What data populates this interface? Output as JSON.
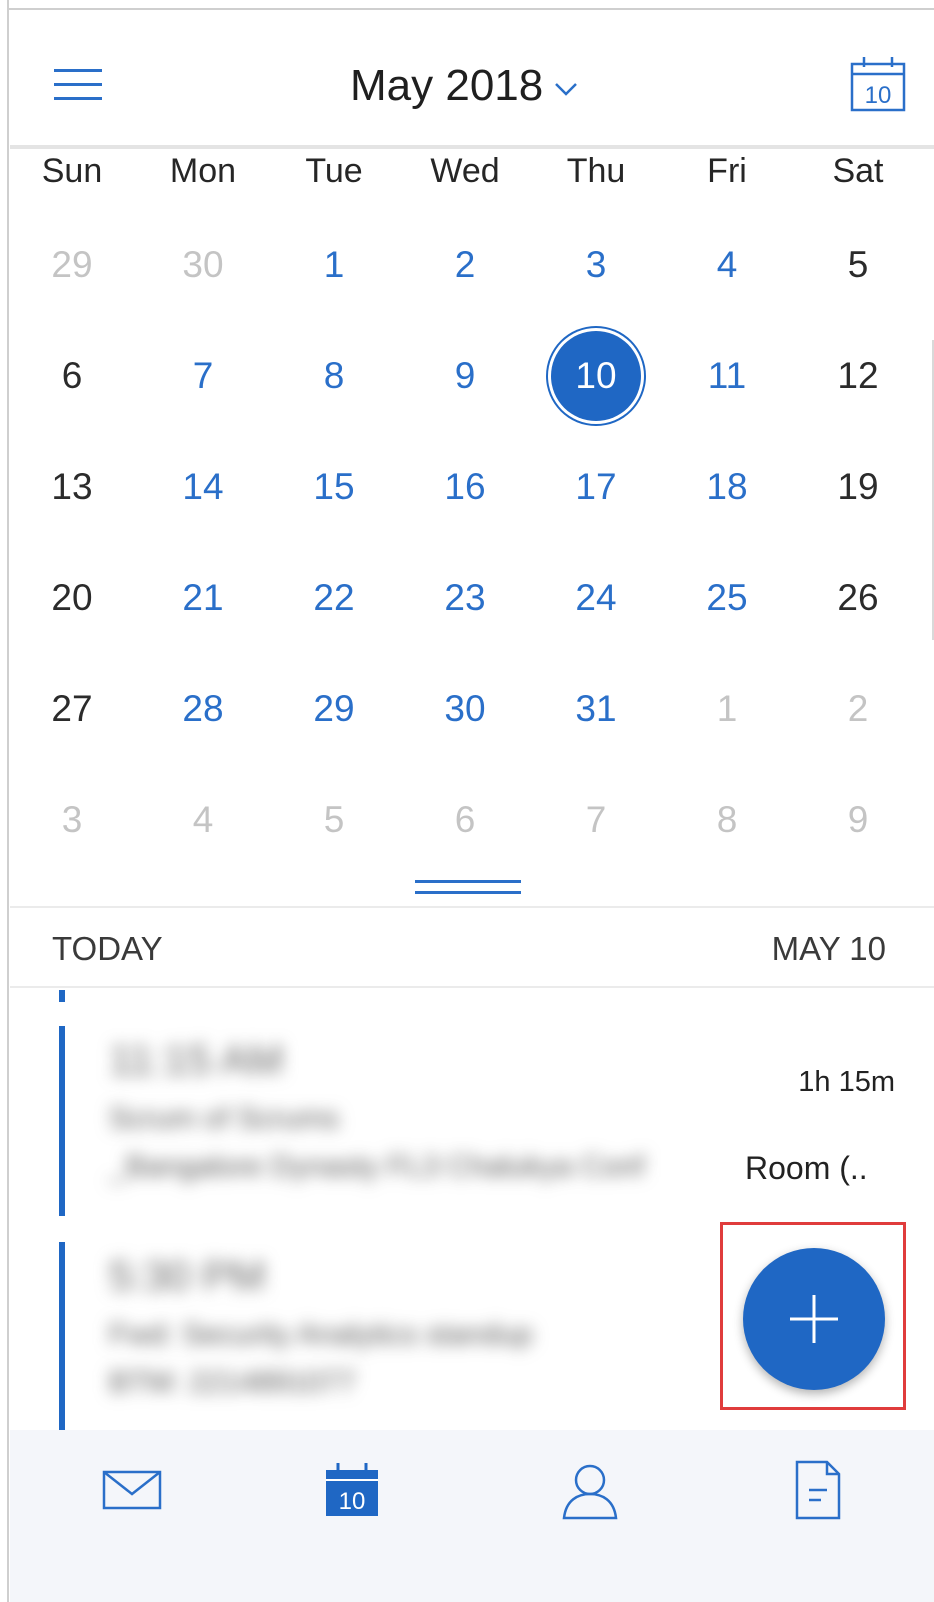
{
  "header": {
    "title": "May 2018",
    "today_icon_day": "10",
    "icons": [
      "hamburger-menu-icon",
      "chevron-down-icon",
      "calendar-today-icon"
    ]
  },
  "weekdays": [
    "Sun",
    "Mon",
    "Tue",
    "Wed",
    "Thu",
    "Fri",
    "Sat"
  ],
  "calendar": {
    "weeks": [
      [
        {
          "d": "29",
          "s": "muted"
        },
        {
          "d": "30",
          "s": "muted"
        },
        {
          "d": "1",
          "s": "week"
        },
        {
          "d": "2",
          "s": "week"
        },
        {
          "d": "3",
          "s": "week"
        },
        {
          "d": "4",
          "s": "week"
        },
        {
          "d": "5",
          "s": "weekend"
        }
      ],
      [
        {
          "d": "6",
          "s": "weekend"
        },
        {
          "d": "7",
          "s": "week"
        },
        {
          "d": "8",
          "s": "week"
        },
        {
          "d": "9",
          "s": "week"
        },
        {
          "d": "10",
          "s": "selected"
        },
        {
          "d": "11",
          "s": "week"
        },
        {
          "d": "12",
          "s": "weekend"
        }
      ],
      [
        {
          "d": "13",
          "s": "weekend"
        },
        {
          "d": "14",
          "s": "week"
        },
        {
          "d": "15",
          "s": "week"
        },
        {
          "d": "16",
          "s": "week"
        },
        {
          "d": "17",
          "s": "week"
        },
        {
          "d": "18",
          "s": "week"
        },
        {
          "d": "19",
          "s": "weekend"
        }
      ],
      [
        {
          "d": "20",
          "s": "weekend"
        },
        {
          "d": "21",
          "s": "week"
        },
        {
          "d": "22",
          "s": "week"
        },
        {
          "d": "23",
          "s": "week"
        },
        {
          "d": "24",
          "s": "week"
        },
        {
          "d": "25",
          "s": "week"
        },
        {
          "d": "26",
          "s": "weekend"
        }
      ],
      [
        {
          "d": "27",
          "s": "weekend"
        },
        {
          "d": "28",
          "s": "week"
        },
        {
          "d": "29",
          "s": "week"
        },
        {
          "d": "30",
          "s": "week"
        },
        {
          "d": "31",
          "s": "week"
        },
        {
          "d": "1",
          "s": "muted"
        },
        {
          "d": "2",
          "s": "muted"
        }
      ],
      [
        {
          "d": "3",
          "s": "muted"
        },
        {
          "d": "4",
          "s": "muted"
        },
        {
          "d": "5",
          "s": "muted"
        },
        {
          "d": "6",
          "s": "muted"
        },
        {
          "d": "7",
          "s": "muted"
        },
        {
          "d": "8",
          "s": "muted"
        },
        {
          "d": "9",
          "s": "muted"
        }
      ]
    ]
  },
  "agenda": {
    "today_label": "TODAY",
    "date_label": "MAY 10",
    "events": [
      {
        "time": "11:15 AM",
        "title": "Scrum of Scrums",
        "location": "_Bangalore Dynasty FL3 Chalukya Conf",
        "location_tail": "Room (..",
        "duration": "1h 15m"
      },
      {
        "time": "5:30 PM",
        "title": "Fwd: Security Analytics standup",
        "location": "BTM: 2214891077"
      }
    ]
  },
  "fab": {
    "icon": "plus-icon"
  },
  "bottom_nav": {
    "calendar_icon_day": "10",
    "icons": [
      "mail-icon",
      "calendar-icon",
      "people-icon",
      "files-icon"
    ]
  },
  "colors": {
    "accent": "#1f67c4",
    "weekday_text": "#2a6fc9",
    "muted_text": "#c4c4c4",
    "highlight_box": "#e03c3c"
  }
}
